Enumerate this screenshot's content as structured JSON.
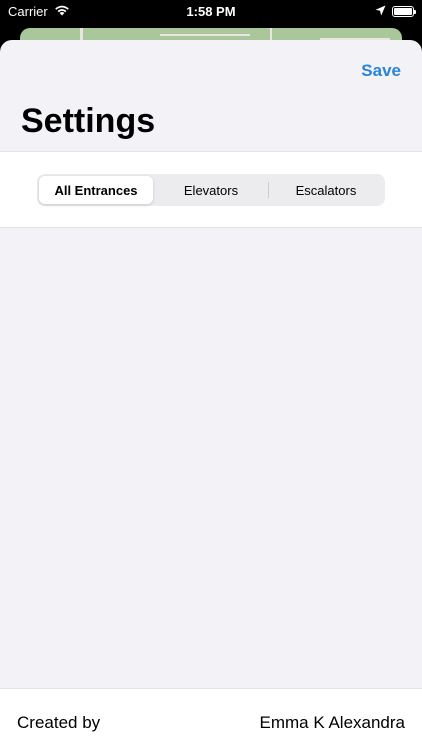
{
  "status_bar": {
    "carrier": "Carrier",
    "time": "1:58 PM",
    "icons": [
      "wifi-icon",
      "location-arrow-icon",
      "battery-icon"
    ],
    "battery_level": 1.0
  },
  "header": {
    "save_label": "Save",
    "title": "Settings"
  },
  "segmented_control": {
    "options": [
      "All Entrances",
      "Elevators",
      "Escalators"
    ],
    "selected_index": 0
  },
  "footer": {
    "label": "Created by",
    "value": "Emma K Alexandra"
  },
  "colors": {
    "accent": "#2a84d8",
    "sheet_background": "#f2f2f7",
    "section_background": "#ffffff"
  }
}
